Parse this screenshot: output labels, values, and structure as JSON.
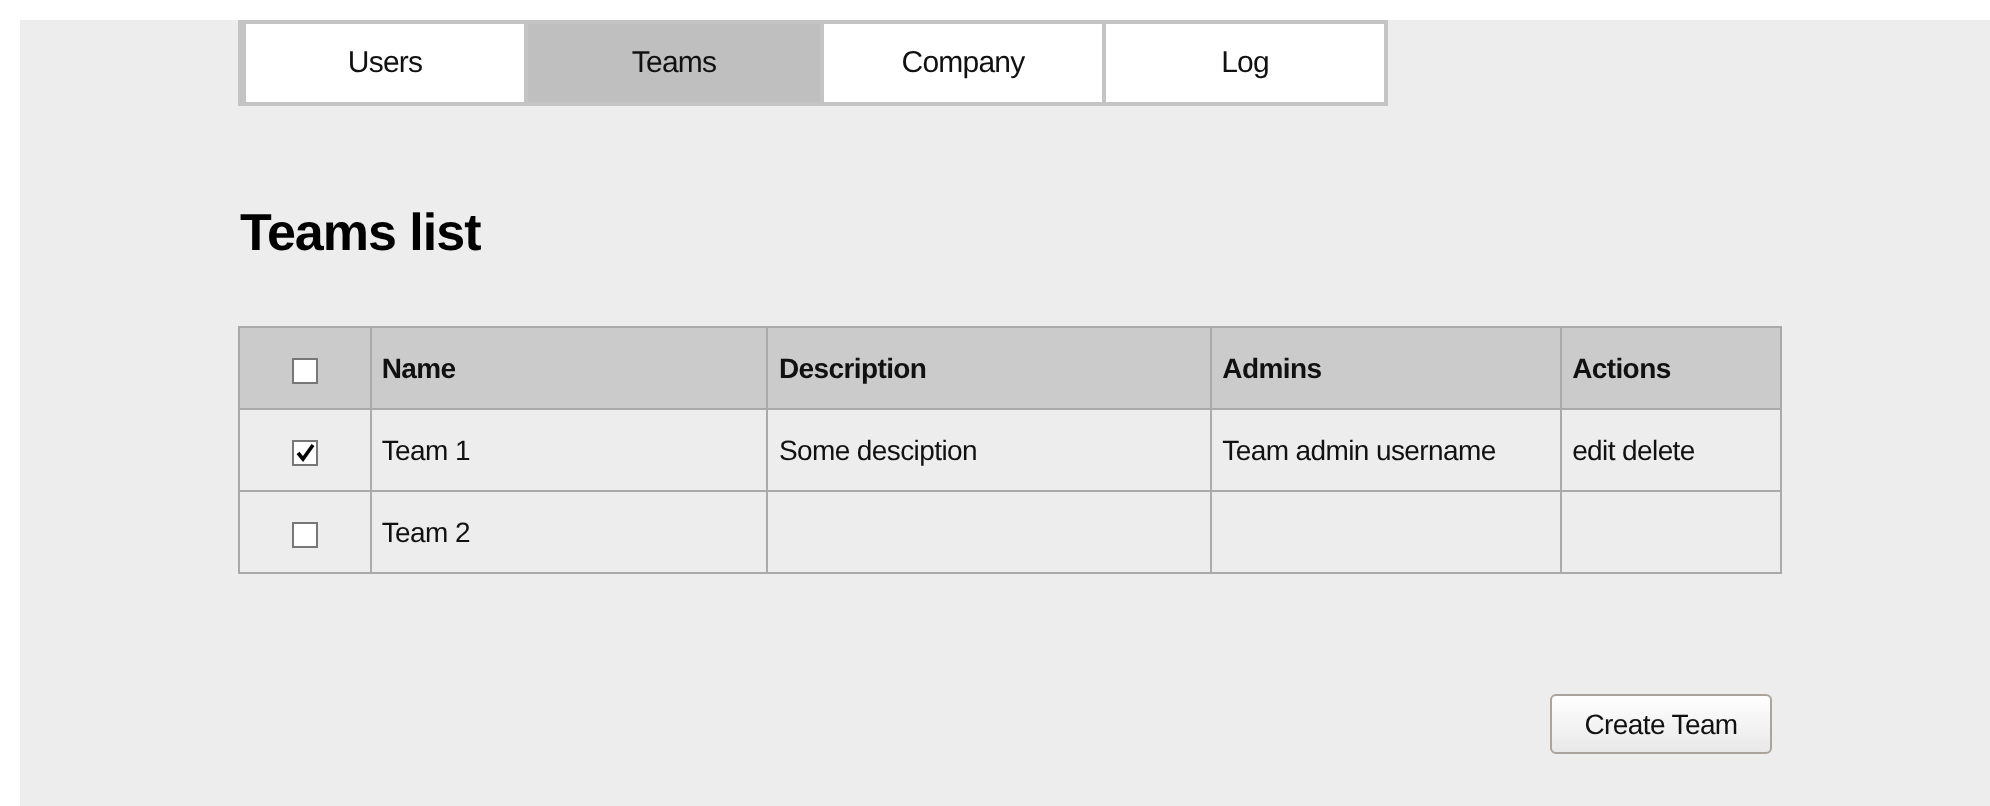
{
  "tabs": [
    {
      "label": "Users",
      "selected": false
    },
    {
      "label": "Teams",
      "selected": true
    },
    {
      "label": "Company",
      "selected": false
    },
    {
      "label": "Log",
      "selected": false
    }
  ],
  "title": "Teams list",
  "table": {
    "select_all": {
      "checked": false
    },
    "columns": [
      "Name",
      "Description",
      "Admins",
      "Actions"
    ],
    "rows": [
      {
        "checked": true,
        "name": "Team 1",
        "description": "Some desciption",
        "admins": "Team admin username",
        "actions": [
          "edit",
          "delete"
        ]
      },
      {
        "checked": false,
        "name": "Team 2"
      }
    ]
  },
  "create_button": "Create Team"
}
